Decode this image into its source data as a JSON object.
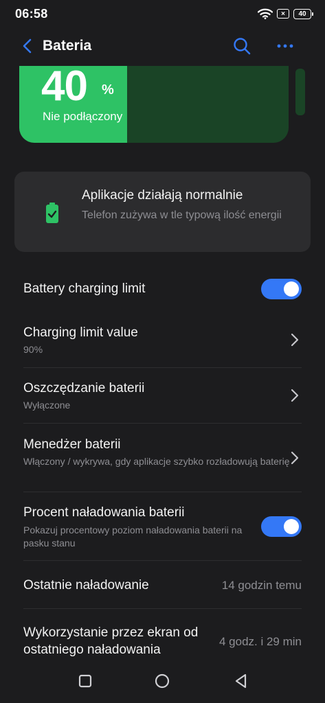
{
  "status_bar": {
    "time": "06:58",
    "battery_level": "40",
    "sim_indicator": "×"
  },
  "header": {
    "title": "Bateria"
  },
  "battery": {
    "percent": "40",
    "percent_sign": "%",
    "status": "Nie podłączony",
    "level_fraction": 0.4,
    "fill_color": "#2ec265",
    "track_color": "#1a4426"
  },
  "info_card": {
    "title": "Aplikacje działają normalnie",
    "description": "Telefon zużywa w tle typową ilość energii",
    "icon": "battery-check-icon"
  },
  "settings": {
    "charging_limit": {
      "title": "Battery charging limit",
      "enabled": true
    },
    "charging_limit_value": {
      "title": "Charging limit value",
      "subtitle": "90%"
    },
    "battery_saver": {
      "title": "Oszczędzanie baterii",
      "subtitle": "Wyłączone"
    },
    "battery_manager": {
      "title": "Menedżer baterii",
      "subtitle": "Włączony / wykrywa, gdy aplikacje szybko rozładowują baterię"
    },
    "battery_percentage": {
      "title": "Procent naładowania baterii",
      "subtitle": "Pokazuj procentowy poziom naładowania baterii na pasku stanu",
      "enabled": true
    },
    "last_charge": {
      "title": "Ostatnie naładowanie",
      "value": "14 godzin temu"
    },
    "screen_usage": {
      "title": "Wykorzystanie przez ekran od ostatniego naładowania",
      "value": "4 godz. i 29 min"
    }
  },
  "colors": {
    "accent": "#3478f6",
    "background": "#1c1c1e",
    "card": "#2c2c2e"
  },
  "nav": {
    "recent": "square-icon",
    "home": "circle-icon",
    "back": "triangle-back-icon"
  }
}
